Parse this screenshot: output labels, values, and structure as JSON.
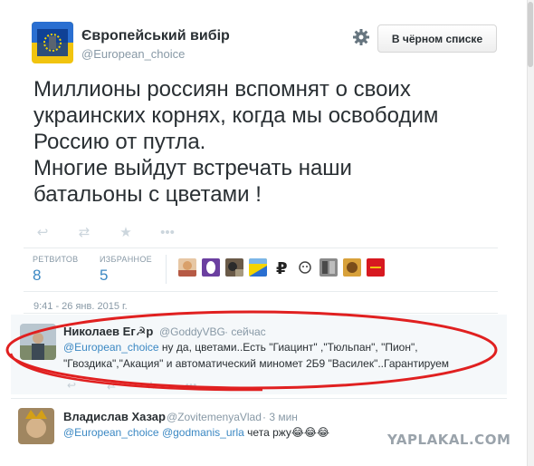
{
  "tweet": {
    "author_name": "Європейський вибір",
    "author_handle": "@European_choice",
    "blocked_button_label": "В чёрном списке",
    "text_lines": [
      "Миллионы россиян вспомнят о своих",
      "украинских корнях, когда мы освободим",
      "Россию от путла.",
      "Многие выйдут встречать наши",
      "батальоны с цветами !"
    ],
    "stats": {
      "retweets_label": "РЕТВИТОВ",
      "retweets_value": "8",
      "favorites_label": "ИЗБРАННОЕ",
      "favorites_value": "5"
    },
    "timestamp": "9:41 - 26 янв. 2015 г.",
    "action_icons": [
      "reply-icon",
      "retweet-icon",
      "favorite-icon",
      "more-icon"
    ]
  },
  "replies": [
    {
      "name": "Николаев Ег☭р",
      "handle": "@GoddyVBG",
      "time": "· сейчас",
      "line1_mention": "@European_choice",
      "line1_text": " ну да, цветами..Есть \"Гиацинт\" ,\"Тюльпан\", \"Пион\",",
      "line2_text": "\"Гвоздика\",\"Акация\" и автоматический миномет 2Б9 \"Василек\"..Гарантируем"
    },
    {
      "name": "Владислав Хазар",
      "handle": "@ZovitemenyaVlad",
      "time": "· 3 мин",
      "mention1": "@European_choice",
      "mention2": "@godmanis_urla",
      "text": " чета ржу😂😂😂"
    }
  ],
  "watermark": "YAPLAKAL.COM",
  "colors": {
    "link": "#3b88c3",
    "text": "#292f33",
    "muted": "#8899a6",
    "annotation_ellipse": "#e02020"
  }
}
